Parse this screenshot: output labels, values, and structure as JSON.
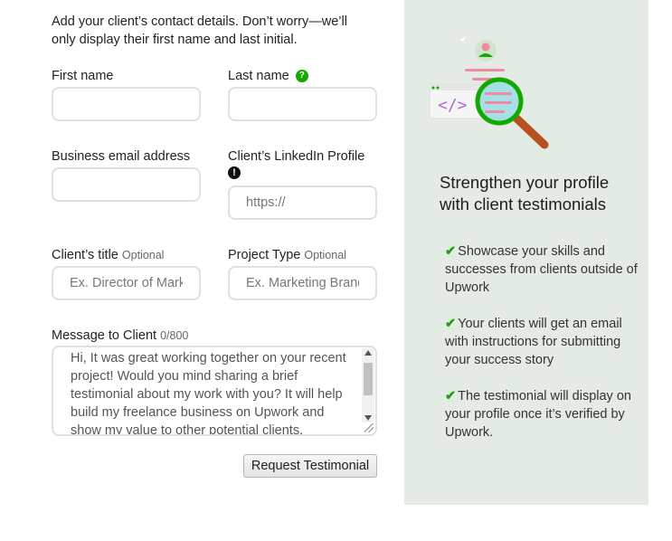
{
  "form": {
    "intro": "Add your client’s contact details. Don’t worry—we’ll only display their first name and last initial.",
    "first_name": {
      "label": "First name",
      "value": ""
    },
    "last_name": {
      "label": "Last name",
      "value": "",
      "help_icon": "?"
    },
    "email": {
      "label": "Business email address",
      "value": ""
    },
    "linkedin": {
      "label": "Client’s LinkedIn Profile",
      "placeholder": "https://",
      "warning_icon": "!"
    },
    "client_title": {
      "label": "Client’s title",
      "optional": "Optional",
      "placeholder": "Ex. Director of Marketing"
    },
    "project_type": {
      "label": "Project Type",
      "optional": "Optional",
      "placeholder": "Ex. Marketing Brand Strategy"
    },
    "message": {
      "label": "Message to Client",
      "counter": "0/800",
      "value": "Hi, It was great working together on your recent project! Would you mind sharing a brief testimonial about my work with you? It will help build my freelance business on Upwork and show my value to other potential clients."
    },
    "submit_label": "Request Testimonial"
  },
  "side": {
    "title": "Strengthen your profile with client testimonials",
    "check_glyph": "✔",
    "benefits": [
      "Showcase your skills and successes from clients outside of Upwork",
      "Your clients will get an email with instructions for submitting your success story",
      "The testimonial will display on your profile once it’s verified by Upwork."
    ]
  },
  "colors": {
    "accent": "#14a800",
    "panel_bg": "#e4ebe4",
    "border": "#e0e0e0"
  },
  "icons": [
    "help-icon",
    "warning-icon",
    "check-icon",
    "magnifier-illustration",
    "code-icon"
  ]
}
